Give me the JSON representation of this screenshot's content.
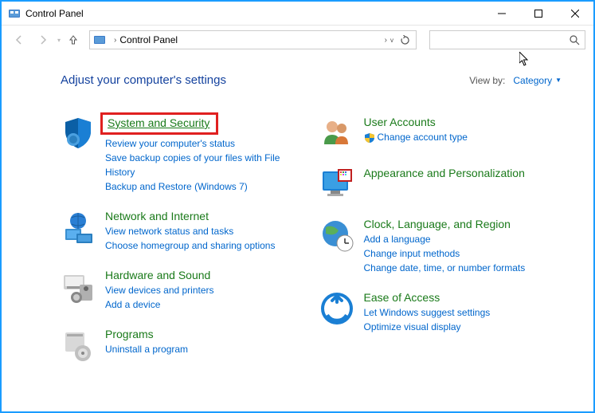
{
  "window": {
    "title": "Control Panel"
  },
  "address": {
    "location": "Control Panel",
    "search_placeholder": ""
  },
  "header": {
    "title": "Adjust your computer's settings",
    "viewby_label": "View by:",
    "viewby_value": "Category"
  },
  "categories": {
    "left": [
      {
        "title": "System and Security",
        "highlighted": true,
        "links": [
          "Review your computer's status",
          "Save backup copies of your files with File History",
          "Backup and Restore (Windows 7)"
        ]
      },
      {
        "title": "Network and Internet",
        "links": [
          "View network status and tasks",
          "Choose homegroup and sharing options"
        ]
      },
      {
        "title": "Hardware and Sound",
        "links": [
          "View devices and printers",
          "Add a device"
        ]
      },
      {
        "title": "Programs",
        "links": [
          "Uninstall a program"
        ]
      }
    ],
    "right": [
      {
        "title": "User Accounts",
        "links": [
          "Change account type"
        ],
        "shield": true
      },
      {
        "title": "Appearance and Personalization",
        "links": []
      },
      {
        "title": "Clock, Language, and Region",
        "links": [
          "Add a language",
          "Change input methods",
          "Change date, time, or number formats"
        ]
      },
      {
        "title": "Ease of Access",
        "links": [
          "Let Windows suggest settings",
          "Optimize visual display"
        ]
      }
    ]
  }
}
